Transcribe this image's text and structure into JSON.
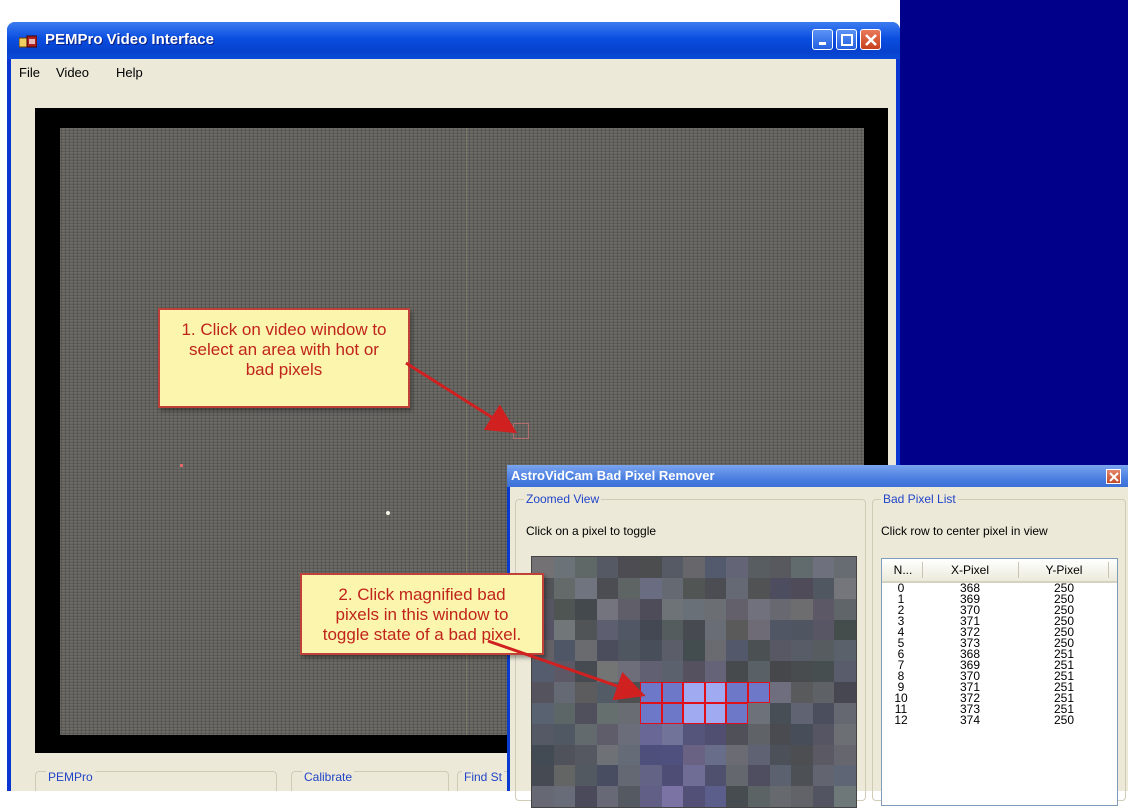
{
  "window": {
    "title": "PEMPro Video Interface",
    "menu": [
      "File",
      "Video",
      "Help"
    ]
  },
  "bottom_panel": {
    "groups": [
      "PEMPro",
      "Calibrate",
      "Find St"
    ]
  },
  "callouts": {
    "first": [
      "1. Click on video window to",
      "select an area with hot or",
      "bad pixels"
    ],
    "second": [
      "2. Click magnified bad",
      "pixels in this window to",
      "toggle state of a bad pixel."
    ]
  },
  "dialog": {
    "title": "AstroVidCam Bad Pixel Remover",
    "zoomed_view": {
      "label": "Zoomed View",
      "hint": "Click on a pixel to toggle"
    },
    "bad_pixel_list": {
      "label": "Bad Pixel List",
      "hint": "Click row to center pixel in view",
      "columns": [
        "N...",
        "X-Pixel",
        "Y-Pixel"
      ],
      "rows": [
        [
          "0",
          "368",
          "250"
        ],
        [
          "1",
          "369",
          "250"
        ],
        [
          "2",
          "370",
          "250"
        ],
        [
          "3",
          "371",
          "250"
        ],
        [
          "4",
          "372",
          "250"
        ],
        [
          "5",
          "373",
          "250"
        ],
        [
          "6",
          "368",
          "251"
        ],
        [
          "7",
          "369",
          "251"
        ],
        [
          "8",
          "370",
          "251"
        ],
        [
          "9",
          "371",
          "251"
        ],
        [
          "10",
          "372",
          "251"
        ],
        [
          "11",
          "373",
          "251"
        ],
        [
          "12",
          "374",
          "250"
        ]
      ]
    }
  },
  "colors": {
    "desktop": "#00008a",
    "titlebar": "#0a4ee0",
    "callout_fill": "#fbf5ae",
    "callout_text": "#c0241a",
    "selection_outline": "#e0101a"
  }
}
